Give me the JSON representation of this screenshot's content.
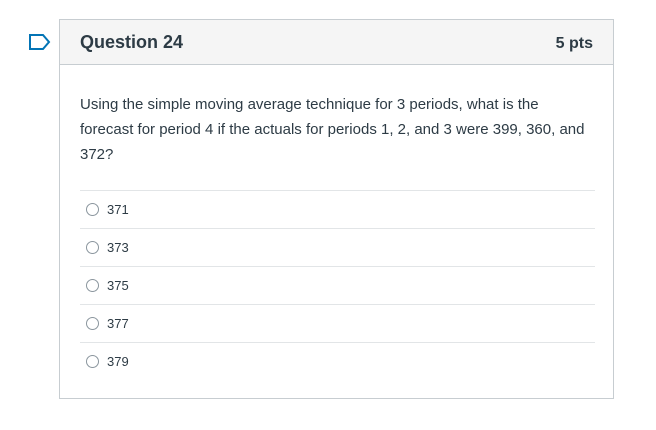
{
  "question": {
    "title": "Question 24",
    "points": "5 pts",
    "text": "Using the simple moving average technique for 3 periods, what is the forecast for period 4 if the actuals for periods 1, 2, and 3 were 399, 360, and 372?",
    "flag_icon": "flag-outline-icon"
  },
  "answers": [
    {
      "label": "371"
    },
    {
      "label": "373"
    },
    {
      "label": "375"
    },
    {
      "label": "377"
    },
    {
      "label": "379"
    }
  ],
  "colors": {
    "accent": "#0374b5",
    "text": "#2d3b45",
    "border": "#c7cdd1",
    "header_bg": "#f5f5f5"
  }
}
